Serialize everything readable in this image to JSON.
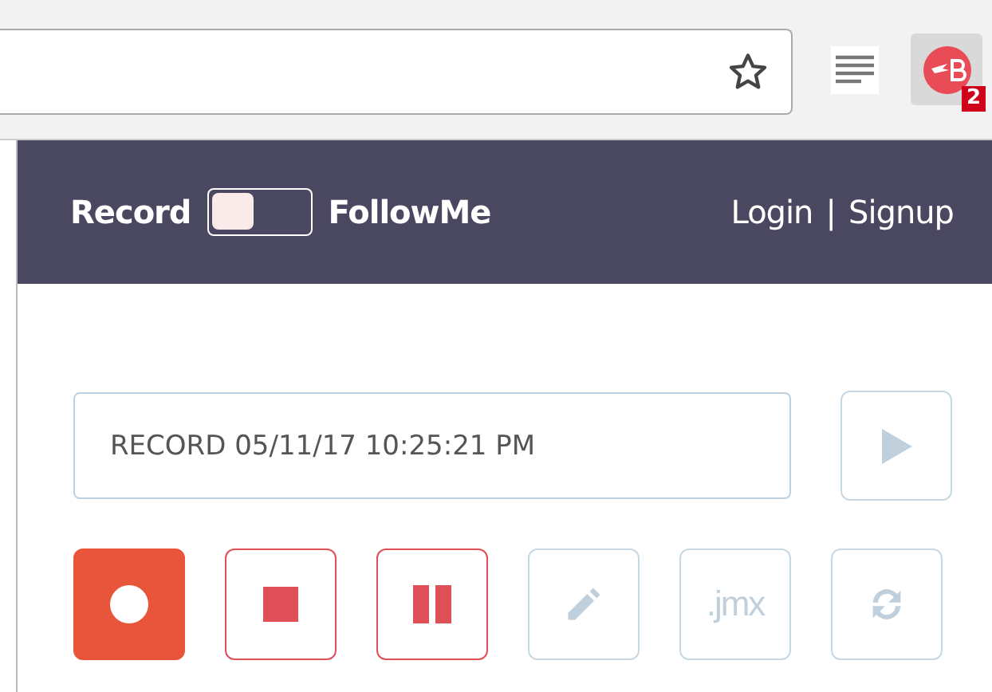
{
  "browser": {
    "extension_badge": "2"
  },
  "header": {
    "record_label": "Record",
    "follow_toggle": {
      "on": false
    },
    "followme_label": "FollowMe",
    "login": "Login",
    "separator": "|",
    "signup": "Signup"
  },
  "test_name": {
    "value": "RECORD 05/11/17 10:25:21 PM"
  },
  "play_button": {
    "disabled": true
  },
  "controls": [
    {
      "kind": "record",
      "active": true,
      "disabled": false
    },
    {
      "kind": "stop",
      "active": false,
      "disabled": false
    },
    {
      "kind": "pause",
      "active": false,
      "disabled": false
    },
    {
      "kind": "edit",
      "active": false,
      "disabled": true
    },
    {
      "kind": "jmx",
      "label": ".jmx",
      "active": false,
      "disabled": true
    },
    {
      "kind": "refresh",
      "active": false,
      "disabled": true
    }
  ]
}
